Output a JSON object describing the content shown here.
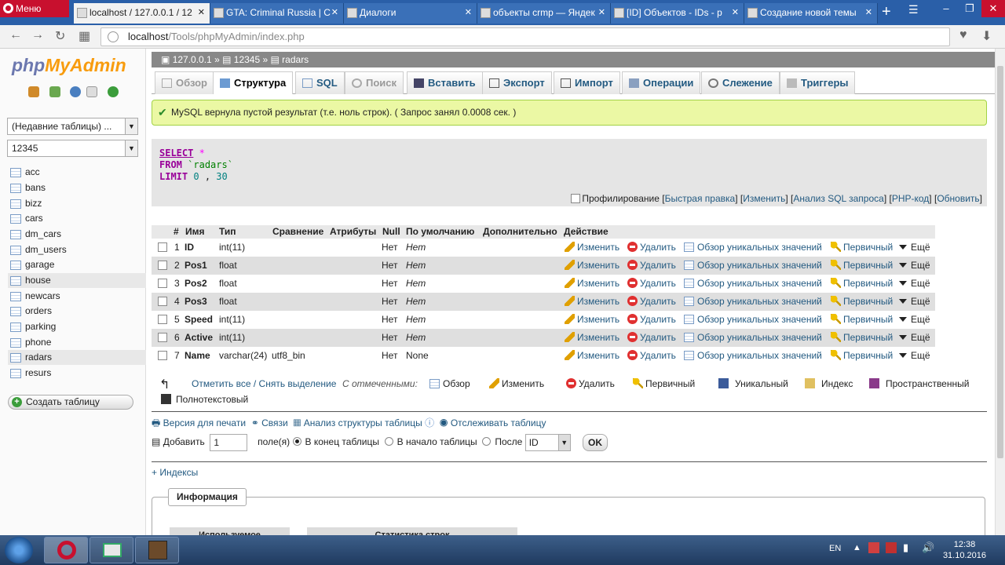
{
  "browser": {
    "menu_label": "Меню",
    "tabs": [
      {
        "title": "localhost / 127.0.0.1 / 12"
      },
      {
        "title": "GTA: Criminal Russia | C"
      },
      {
        "title": "Диалоги"
      },
      {
        "title": "объекты crmp — Яндек"
      },
      {
        "title": "[ID] Объектов - IDs - p"
      },
      {
        "title": "Создание новой темы"
      }
    ],
    "url_host": "localhost",
    "url_path": "/Tools/phpMyAdmin/index.php"
  },
  "sidebar": {
    "logo_php": "php",
    "logo_myadmin": "MyAdmin",
    "recent_tables": "(Недавние таблицы) ...",
    "db_select": "12345",
    "tables": [
      "acc",
      "bans",
      "bizz",
      "cars",
      "dm_cars",
      "dm_users",
      "garage",
      "house",
      "newcars",
      "orders",
      "parking",
      "phone",
      "radars",
      "resurs"
    ],
    "create_table": "Создать таблицу"
  },
  "breadcrumb": {
    "server": "127.0.0.1",
    "db": "12345",
    "table": "radars"
  },
  "tabs": [
    "Обзор",
    "Структура",
    "SQL",
    "Поиск",
    "Вставить",
    "Экспорт",
    "Импорт",
    "Операции",
    "Слежение",
    "Триггеры"
  ],
  "message": "MySQL вернула пустой результат (т.е. ноль строк). ( Запрос занял 0.0008 сек. )",
  "sql": {
    "select_kw": "SELECT",
    "star": "*",
    "from_kw": "FROM",
    "table": "`radars`",
    "limit_kw": "LIMIT",
    "limit_a": "0",
    "comma": ",",
    "limit_b": "30"
  },
  "profiling": {
    "label": "Профилирование",
    "open": "[",
    "quick_edit": "Быстрая правка",
    "sep": "] [",
    "edit": "Изменить",
    "analyze": "Анализ SQL запроса",
    "php_code": "PHP-код",
    "refresh": "Обновить",
    "close": "]"
  },
  "columns_header": [
    "#",
    "Имя",
    "Тип",
    "Сравнение",
    "Атрибуты",
    "Null",
    "По умолчанию",
    "Дополнительно",
    "Действие"
  ],
  "rows": [
    {
      "num": "1",
      "name": "ID",
      "type": "int(11)",
      "collation": "",
      "null": "Нет",
      "default": "Нет"
    },
    {
      "num": "2",
      "name": "Pos1",
      "type": "float",
      "collation": "",
      "null": "Нет",
      "default": "Нет"
    },
    {
      "num": "3",
      "name": "Pos2",
      "type": "float",
      "collation": "",
      "null": "Нет",
      "default": "Нет"
    },
    {
      "num": "4",
      "name": "Pos3",
      "type": "float",
      "collation": "",
      "null": "Нет",
      "default": "Нет"
    },
    {
      "num": "5",
      "name": "Speed",
      "type": "int(11)",
      "collation": "",
      "null": "Нет",
      "default": "Нет"
    },
    {
      "num": "6",
      "name": "Active",
      "type": "int(11)",
      "collation": "",
      "null": "Нет",
      "default": "Нет"
    },
    {
      "num": "7",
      "name": "Name",
      "type": "varchar(24)",
      "collation": "utf8_bin",
      "null": "Нет",
      "default": "None"
    }
  ],
  "row_actions": {
    "edit": "Изменить",
    "delete": "Удалить",
    "distinct": "Обзор уникальных значений",
    "primary": "Первичный",
    "more": "Ещё"
  },
  "bulk": {
    "check_all": "Отметить все / Снять выделение",
    "with_selected": "С отмеченными:",
    "browse": "Обзор",
    "edit": "Изменить",
    "delete": "Удалить",
    "primary": "Первичный",
    "unique": "Уникальный",
    "index": "Индекс",
    "spatial": "Пространственный",
    "fulltext": "Полнотекстовый"
  },
  "links": {
    "print": "Версия для печати",
    "relations": "Связи",
    "analyze": "Анализ структуры таблицы",
    "track": "Отслеживать таблицу"
  },
  "add_row": {
    "add": "Добавить",
    "count": "1",
    "fields": "поле(я)",
    "at_end": "В конец таблицы",
    "at_begin": "В начало таблицы",
    "after": "После",
    "after_field": "ID",
    "ok": "OK"
  },
  "indexes": "+ Индексы",
  "info": {
    "legend": "Информация",
    "space": "Используемое",
    "rowstats": "Статистика строк"
  },
  "taskbar": {
    "lang": "EN",
    "time": "12:38",
    "date": "31.10.2016"
  }
}
